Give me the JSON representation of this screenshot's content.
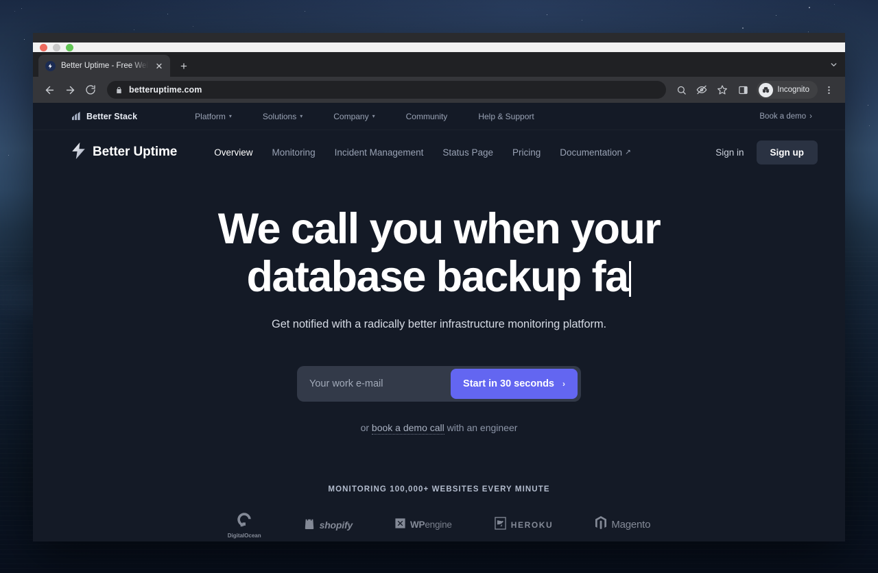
{
  "window_controls": {
    "close": "close-window",
    "minimize": "minimize-window",
    "maximize": "maximize-window"
  },
  "browser": {
    "tab": {
      "title": "Better Uptime - Free Web Mon",
      "favicon": "lightning-bolt-favicon",
      "close_label": "✕"
    },
    "new_tab_label": "+",
    "tabstrip_chevron": "chevron-down-icon",
    "toolbar": {
      "back_label": "back-icon",
      "forward_label": "forward-icon",
      "reload_label": "reload-icon",
      "lock_label": "lock-icon",
      "url": "betteruptime.com",
      "zoom_label": "zoom-search-icon",
      "eye_label": "eye-slash-icon",
      "bookmark_label": "star-icon",
      "sidepanel_label": "side-panel-icon",
      "profile_label": "Incognito"
    }
  },
  "stackbar": {
    "brand": "Better Stack",
    "brand_icon": "better-stack-bars-logo",
    "nav": [
      {
        "label": "Platform",
        "has_caret": true,
        "caret": "▾"
      },
      {
        "label": "Solutions",
        "has_caret": true,
        "caret": "▾"
      },
      {
        "label": "Company",
        "has_caret": true,
        "caret": "▾"
      },
      {
        "label": "Community",
        "has_caret": false,
        "caret": ""
      },
      {
        "label": "Help & Support",
        "has_caret": false,
        "caret": ""
      }
    ],
    "cta": {
      "label": "Book a demo",
      "arrow": "›"
    }
  },
  "productnav": {
    "brand": "Better Uptime",
    "brand_icon": "lightning-bolt-logo",
    "items": [
      {
        "label": "Overview",
        "active": true,
        "external": ""
      },
      {
        "label": "Monitoring",
        "active": false,
        "external": ""
      },
      {
        "label": "Incident Management",
        "active": false,
        "external": ""
      },
      {
        "label": "Status Page",
        "active": false,
        "external": ""
      },
      {
        "label": "Pricing",
        "active": false,
        "external": ""
      },
      {
        "label": "Documentation",
        "active": false,
        "external": "↗"
      }
    ],
    "signin_label": "Sign in",
    "signup_label": "Sign up"
  },
  "hero": {
    "headline": "We call you when your database backup fa",
    "headline_full_hint": "typewriter animation in progress",
    "subhead": "Get notified with a radically better infrastructure monitoring platform.",
    "form": {
      "email_value": "",
      "email_placeholder": "Your work e-mail",
      "cta_label": "Start in 30 seconds",
      "cta_arrow": "›"
    },
    "demo": {
      "prefix": "or ",
      "link": "book a demo call",
      "suffix": " with an engineer"
    }
  },
  "social_proof": {
    "label": "MONITORING 100,000+ WEBSITES EVERY MINUTE",
    "logos": [
      {
        "name": "DigitalOcean",
        "icon": "digitalocean-logo"
      },
      {
        "name": "shopify",
        "icon": "shopify-bag-logo"
      },
      {
        "name": "WP",
        "name_thin": "engine",
        "icon": "wpengine-logo"
      },
      {
        "name": "HEROKU",
        "icon": "heroku-logo"
      },
      {
        "name": "Magento",
        "icon": "magento-logo"
      }
    ]
  },
  "colors": {
    "page_bg": "#141a26",
    "cta_purple": "#6366f1",
    "input_bg": "#333a49",
    "signup_btn": "#2a3242",
    "browser_chrome": "#35363a",
    "tabstrip": "#202124"
  }
}
